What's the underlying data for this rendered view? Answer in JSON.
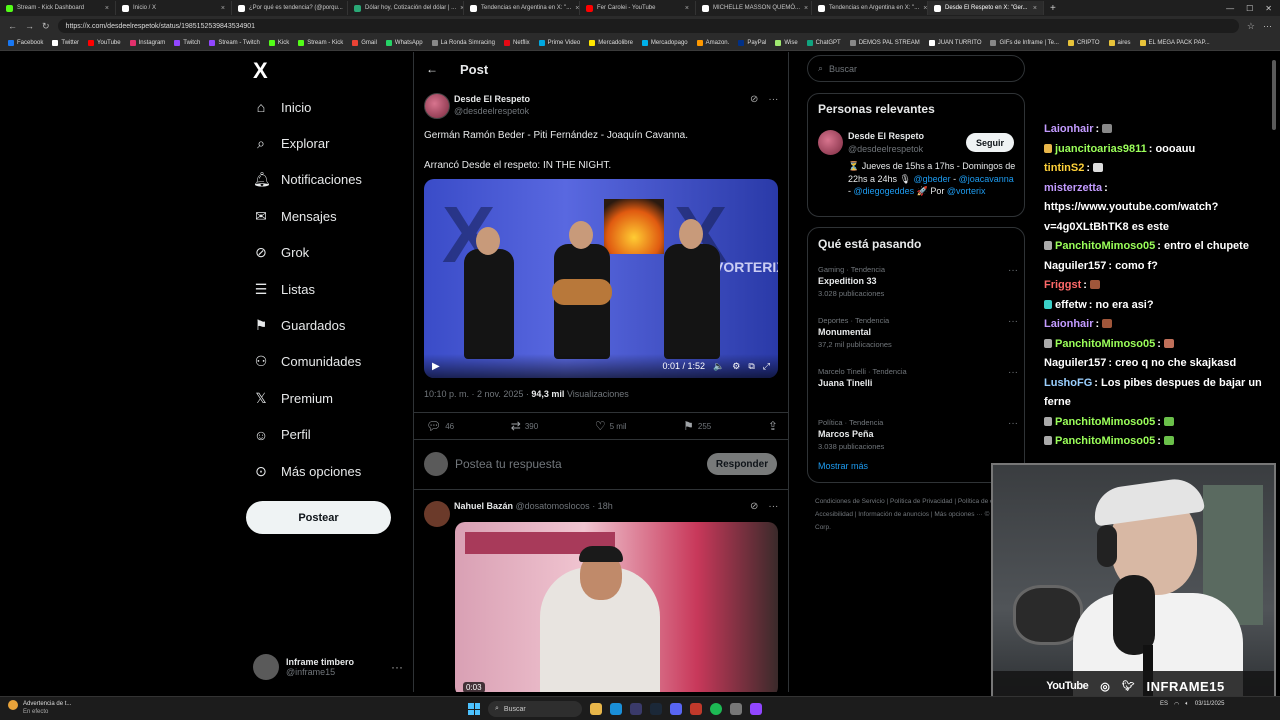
{
  "browser": {
    "tabs": [
      {
        "title": "Stream - Kick Dashboard",
        "color": "#53fc18",
        "active": false
      },
      {
        "title": "Inicio / X",
        "color": "#ffffff",
        "active": false
      },
      {
        "title": "¿Por qué es tendencia? (@porqu...",
        "color": "#ffffff",
        "active": false
      },
      {
        "title": "Dólar hoy, Cotización del dólar | ...",
        "color": "#2aa876",
        "active": false
      },
      {
        "title": "Tendencias en Argentina en X: \"...",
        "color": "#ffffff",
        "active": false
      },
      {
        "title": "Fer Carolei - YouTube",
        "color": "#ff0000",
        "active": false
      },
      {
        "title": "MICHELLE MASSON QUEMÓ...",
        "color": "#ffffff",
        "active": false
      },
      {
        "title": "Tendencias en Argentina en X: \"...",
        "color": "#ffffff",
        "active": false
      },
      {
        "title": "Desde El Respeto en X: \"Ger...",
        "color": "#ffffff",
        "active": true
      }
    ],
    "new_tab": "+",
    "url": "https://x.com/desdeelrespetok/status/1985152539843534901",
    "bookmarks": [
      {
        "label": "Facebook",
        "color": "#1877f2"
      },
      {
        "label": "Twitter",
        "color": "#ffffff"
      },
      {
        "label": "YouTube",
        "color": "#ff0000"
      },
      {
        "label": "Instagram",
        "color": "#e1306c"
      },
      {
        "label": "Twitch",
        "color": "#9146ff"
      },
      {
        "label": "Stream - Twitch",
        "color": "#9146ff"
      },
      {
        "label": "Kick",
        "color": "#53fc18"
      },
      {
        "label": "Stream - Kick",
        "color": "#53fc18"
      },
      {
        "label": "Gmail",
        "color": "#ea4335"
      },
      {
        "label": "WhatsApp",
        "color": "#25d366"
      },
      {
        "label": "La Ronda Simracing",
        "color": "#888888"
      },
      {
        "label": "Netflix",
        "color": "#e50914"
      },
      {
        "label": "Prime Video",
        "color": "#00a8e1"
      },
      {
        "label": "Mercadolibre",
        "color": "#ffe600"
      },
      {
        "label": "Mercadopago",
        "color": "#00b1ea"
      },
      {
        "label": "Amazon.",
        "color": "#ff9900"
      },
      {
        "label": "PayPal",
        "color": "#003087"
      },
      {
        "label": "Wise",
        "color": "#9fe870"
      },
      {
        "label": "ChatGPT",
        "color": "#10a37f"
      },
      {
        "label": "DEMOS PAL STREAM",
        "color": "#888888"
      },
      {
        "label": "JUAN TURRITO",
        "color": "#ffffff"
      },
      {
        "label": "GIFs de Inframe | Te...",
        "color": "#888888"
      },
      {
        "label": "CRIPTO",
        "color": "#e8c33a"
      },
      {
        "label": "aires",
        "color": "#e8c33a"
      },
      {
        "label": "EL MEGA PACK PAP...",
        "color": "#e8c33a"
      }
    ]
  },
  "nav": {
    "logo": "X",
    "items": [
      {
        "label": "Inicio",
        "icon": "home-icon"
      },
      {
        "label": "Explorar",
        "icon": "search-icon"
      },
      {
        "label": "Notificaciones",
        "icon": "bell-icon"
      },
      {
        "label": "Mensajes",
        "icon": "mail-icon"
      },
      {
        "label": "Grok",
        "icon": "grok-icon"
      },
      {
        "label": "Listas",
        "icon": "list-icon"
      },
      {
        "label": "Guardados",
        "icon": "bookmark-icon"
      },
      {
        "label": "Comunidades",
        "icon": "people-icon"
      },
      {
        "label": "Premium",
        "icon": "x-icon"
      },
      {
        "label": "Perfil",
        "icon": "person-icon"
      },
      {
        "label": "Más opciones",
        "icon": "more-circle-icon"
      }
    ],
    "post_button": "Postear",
    "account": {
      "name": "Inframe timbero",
      "handle": "@inframe15"
    }
  },
  "main": {
    "header": "Post",
    "post": {
      "author": "Desde El Respeto",
      "handle": "@desdeelrespetok",
      "text": "Germán Ramón Beder - Piti Fernández - Joaquín Cavanna.\n\nArrancó Desde el respeto: IN THE NIGHT.",
      "video_brand": "VORTERIX",
      "video_time": "0:01 / 1:52",
      "timestamp": "10:10 p. m. · 2 nov. 2025 · ",
      "views_count": "94,3 mil",
      "views_label": " Visualizaciones",
      "replies": "46",
      "reposts": "390",
      "likes": "5 mil",
      "bookmarks": "255"
    },
    "reply_placeholder": "Postea tu respuesta",
    "reply_button": "Responder",
    "second_post": {
      "author": "Nahuel Bazán",
      "meta": " @dosatomoslocos · 18h",
      "video_time": "0:03"
    }
  },
  "sidebar": {
    "search_placeholder": "Buscar",
    "relevant_title": "Personas relevantes",
    "relevant": {
      "name": "Desde El Respeto",
      "handle": "@desdeelrespetok",
      "follow": "Seguir",
      "bio_text": "⏳ Jueves de 15hs a 17hs - Domingos de 22hs a 24hs 🎙 ",
      "bio_link1": "@gbeder",
      "bio_sep1": " - ",
      "bio_link2": "@joacavanna",
      "bio_sep2": " - ",
      "bio_link3": "@diegogeddes",
      "bio_sep3": " 🚀 Por ",
      "bio_link4": "@vorterix"
    },
    "trends_title": "Qué está pasando",
    "trends": [
      {
        "category": "Gaming · Tendencia",
        "name": "Expedition 33",
        "posts": "3.028 publicaciones"
      },
      {
        "category": "Deportes · Tendencia",
        "name": "Monumental",
        "posts": "37,2 mil publicaciones"
      },
      {
        "category": "Marcelo Tinelli · Tendencia",
        "name": "Juana Tinelli",
        "posts": ""
      },
      {
        "category": "Política · Tendencia",
        "name": "Marcos Peña",
        "posts": "3.038 publicaciones"
      }
    ],
    "show_more": "Mostrar más",
    "footer": "Condiciones de Servicio  |  Política de Privacidad  |  Política de cookies  |  Accesibilidad  |  Información de anuncios  |  Más opciones ···  © 2025 X Corp."
  },
  "chat": [
    {
      "user": "Laionhair",
      "color": "#c39bff",
      "text": "",
      "badge": "",
      "emote": "#888888"
    },
    {
      "user": "juancitoarias9811",
      "color": "#9bff5a",
      "text": " oooauu",
      "badge": "#e8b64a",
      "emote": ""
    },
    {
      "user": "tintinS2",
      "color": "#ffd23a",
      "text": "",
      "badge": "",
      "emote": "#dddddd"
    },
    {
      "user": "misterzetta",
      "color": "#c39bff",
      "text": " https://www.youtube.com/watch?v=4g0XLtBhTK8 es este",
      "badge": "",
      "emote": ""
    },
    {
      "user": "PanchitoMimoso05",
      "color": "#9bff5a",
      "text": " entro el chupete",
      "badge": "#aaaaaa",
      "emote": ""
    },
    {
      "user": "Naguiler157",
      "color": "#ffffff",
      "text": " como f?",
      "badge": "",
      "emote": ""
    },
    {
      "user": "Friggst",
      "color": "#ff6a6a",
      "text": "",
      "badge": "",
      "emote": "#a0563a"
    },
    {
      "user": "effetw",
      "color": "#ffffff",
      "text": " no era asi?",
      "badge": "#3ad0c8",
      "emote": ""
    },
    {
      "user": "Laionhair",
      "color": "#c39bff",
      "text": "",
      "badge": "",
      "emote": "#a0563a"
    },
    {
      "user": "PanchitoMimoso05",
      "color": "#9bff5a",
      "text": "",
      "badge": "#aaaaaa",
      "emote": "#c0705a"
    },
    {
      "user": "Naguiler157",
      "color": "#ffffff",
      "text": " creo q no che skajkasd",
      "badge": "",
      "emote": ""
    },
    {
      "user": "LushoFG",
      "color": "#9bd0ff",
      "text": " Los pibes despues de bajar un ferne",
      "badge": "",
      "emote": ""
    },
    {
      "user": "PanchitoMimoso05",
      "color": "#9bff5a",
      "text": "",
      "badge": "#aaaaaa",
      "emote": "#6ac04a"
    },
    {
      "user": "PanchitoMimoso05",
      "color": "#9bff5a",
      "text": "",
      "badge": "#aaaaaa",
      "emote": "#6ac04a"
    }
  ],
  "webcam": {
    "youtube": "YouTube",
    "streamer": "INFRAME15"
  },
  "taskbar": {
    "notice_title": "Advertencia de t...",
    "notice_sub": "En efecto",
    "search": "Buscar",
    "lang": "ES",
    "time": "",
    "date": "03/11/2025"
  }
}
